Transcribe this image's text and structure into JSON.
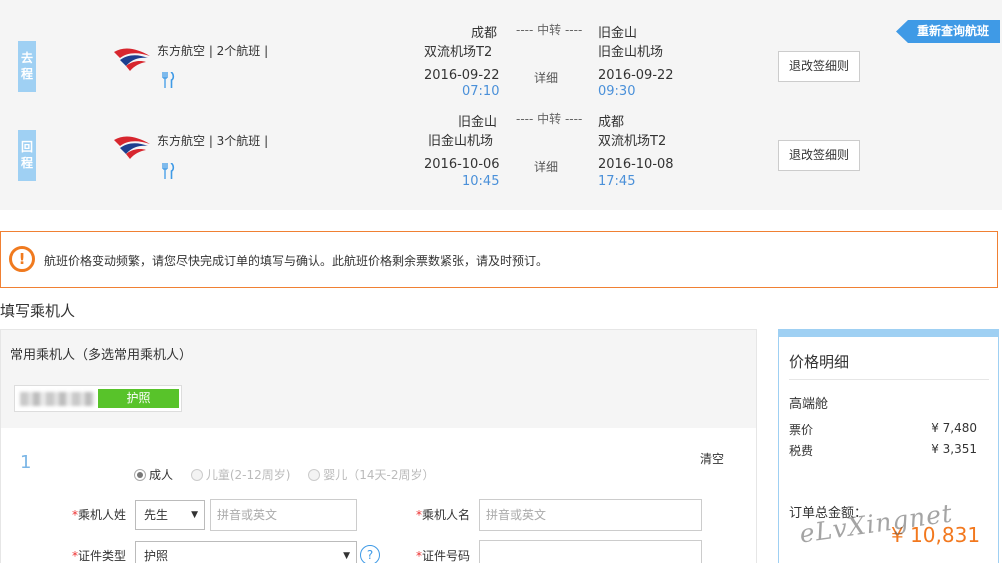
{
  "requery_label": "重新查询航班",
  "legs": [
    {
      "tag": "去程",
      "airline": "东方航空 | 2个航班 |",
      "from_city": "成都",
      "from_airport": "双流机场T2",
      "transfer": "---- 中转 ----",
      "to_city": "旧金山",
      "to_airport": "旧金山机场",
      "dep_date": "2016-09-22",
      "dep_time": "07:10",
      "detail": "详细",
      "arr_date": "2016-09-22",
      "arr_time": "09:30",
      "rule_label": "退改签细则"
    },
    {
      "tag": "回程",
      "airline": "东方航空 | 3个航班 |",
      "from_city": "旧金山",
      "from_airport": "旧金山机场",
      "transfer": "---- 中转 ----",
      "to_city": "成都",
      "to_airport": "双流机场T2",
      "dep_date": "2016-10-06",
      "dep_time": "10:45",
      "detail": "详细",
      "arr_date": "2016-10-08",
      "arr_time": "17:45",
      "rule_label": "退改签细则"
    }
  ],
  "icons": {
    "airline_logo": "china-eastern-logo-icon",
    "meal": "fork-knife-icon",
    "warning": "exclamation-circle-icon",
    "help": "question-circle-icon"
  },
  "colors": {
    "accent": "#3f9ae6",
    "tag_bg": "#9fd0f3",
    "warning": "#f07a1f",
    "passport": "#58c32a",
    "price": "#f2781e"
  },
  "notice": "航班价格变动频繁，请您尽快完成订单的填写与确认。此航班价格剩余票数紧张，请及时预订。",
  "section_title": "填写乘机人",
  "frequent": {
    "title": "常用乘机人（多选常用乘机人）",
    "doc_tag": "护照"
  },
  "passenger": {
    "index": "1",
    "clear": "清空",
    "types": [
      "成人",
      "儿童(2-12周岁)",
      "婴儿（14天-2周岁）"
    ],
    "surname_label": "乘机人姓",
    "title_value": "先生",
    "surname_placeholder": "拼音或英文",
    "givenname_label": "乘机人名",
    "givenname_placeholder": "拼音或英文",
    "idtype_label": "证件类型",
    "idtype_value": "护照",
    "idno_label": "证件号码",
    "idno_value": ""
  },
  "price": {
    "title": "价格明细",
    "cabin": "高端舱",
    "fare_label": "票价",
    "fare_value": "¥ 7,480",
    "tax_label": "税费",
    "tax_value": "¥ 3,351",
    "total_label": "订单总金额：",
    "total_value": "¥ 10,831",
    "watermark": "eLvXingnet"
  }
}
